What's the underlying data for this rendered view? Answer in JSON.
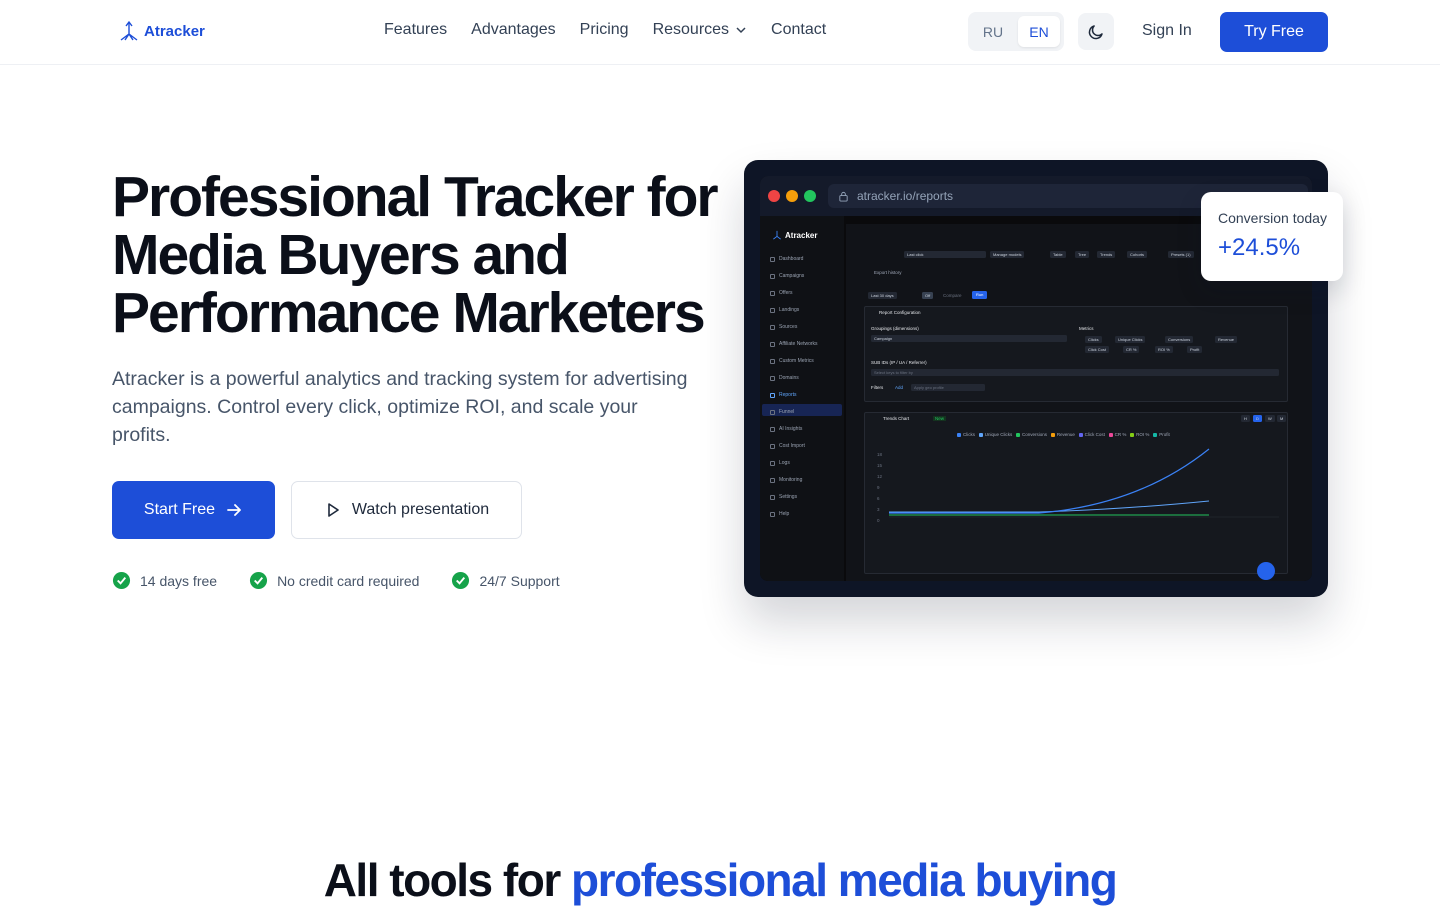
{
  "nav": {
    "brand": "Atracker",
    "links": [
      "Features",
      "Advantages",
      "Pricing",
      "Resources",
      "Contact"
    ],
    "lang_options": [
      "RU",
      "EN"
    ],
    "lang_active": "EN",
    "sign_in": "Sign In",
    "try_free": "Try Free"
  },
  "hero": {
    "title": "Professional Tracker for Media Buyers and Performance Marketers",
    "subtitle": "Atracker is a powerful analytics and tracking system for advertising campaigns. Control every click, optimize ROI, and scale your profits.",
    "start_button": "Start Free",
    "watch_button": "Watch presentation",
    "features": [
      "14 days free",
      "No credit card required",
      "24/7 Support"
    ]
  },
  "mockup": {
    "url": "atracker.io/reports",
    "brand": "Atracker",
    "sidebar": [
      "Dashboard",
      "Campaigns",
      "Offers",
      "Landings",
      "Sources",
      "Affiliate Networks",
      "Custom Metrics",
      "Domains",
      "Reports",
      "Funnel",
      "AI Insights",
      "Cost Import",
      "Logs",
      "Monitoring",
      "Settings",
      "Help"
    ],
    "toolbar": {
      "attribution": "Last click",
      "manage_models": "Manage models",
      "views": [
        "Table",
        "Tree",
        "Trends",
        "Cohorts"
      ],
      "presets": "Presets (1)",
      "export": "Export history"
    },
    "range": "Last 30 days",
    "toggle": "Off",
    "compare": "Compare",
    "run": "Run",
    "config_title": "Report Configuration",
    "groupings_label": "Groupings (dimensions)",
    "grouping_value": "Campaign",
    "metrics_label": "Metrics",
    "metrics": [
      "Clicks",
      "Unique Clicks",
      "Conversions",
      "Revenue",
      "Click Cost",
      "CR %",
      "ROI %",
      "Profit"
    ],
    "sub_ids_label": "SUB IDs (IP / UA / Referrer)",
    "sub_ids_placeholder": "Select keys to filter by",
    "filters_label": "Filters",
    "filters_add": "Add",
    "filters_placeholder": "Apply geo profile",
    "chart_title": "Trends Chart",
    "chart_badge": "New",
    "chart_periods": [
      "H",
      "D",
      "W",
      "M"
    ],
    "legend": [
      {
        "name": "Clicks",
        "color": "#3b82f6"
      },
      {
        "name": "Unique Clicks",
        "color": "#60a5fa"
      },
      {
        "name": "Conversions",
        "color": "#22c55e"
      },
      {
        "name": "Revenue",
        "color": "#f59e0b"
      },
      {
        "name": "Click Cost",
        "color": "#6366f1"
      },
      {
        "name": "CR %",
        "color": "#ec4899"
      },
      {
        "name": "ROI %",
        "color": "#84cc16"
      },
      {
        "name": "Profit",
        "color": "#14b8a6"
      }
    ],
    "y_ticks": [
      "18",
      "15",
      "12",
      "9",
      "6",
      "3",
      "0"
    ]
  },
  "conversion_card": {
    "label": "Conversion today",
    "value": "+24.5%"
  },
  "section": {
    "title_plain": "All tools for ",
    "title_accent": "professional media buying"
  },
  "colors": {
    "primary": "#1d4ed8",
    "success": "#16a34a"
  }
}
